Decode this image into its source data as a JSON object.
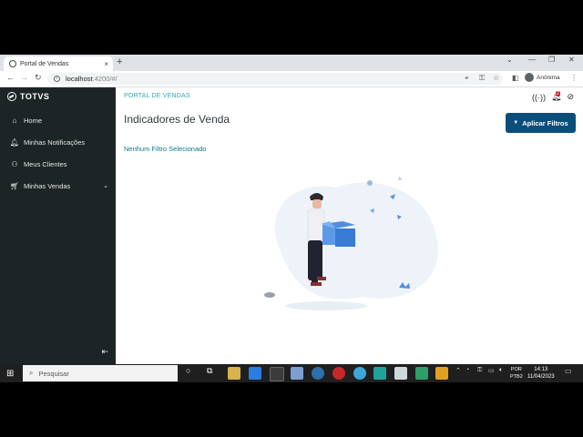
{
  "browser": {
    "tab_title": "Portal de Vendas",
    "tab_close": "×",
    "new_tab": "+",
    "url_host": "localhost",
    "url_path": ":4200/#/",
    "profile_name": "Anônima"
  },
  "app": {
    "brand": "TOTVS",
    "breadcrumb": "PORTAL DE VENDAS",
    "notification_count": "2",
    "page_title": "Indicadores de Venda",
    "apply_button": "Aplicar Filtros",
    "no_filter": "Nenhum Filtro Selecionado",
    "accent": "#2da9b3",
    "primary": "#0c4e7a"
  },
  "sidebar": {
    "items": [
      {
        "label": "Home",
        "icon": "home-icon"
      },
      {
        "label": "Minhas Notificações",
        "icon": "bell-icon"
      },
      {
        "label": "Meus Clientes",
        "icon": "users-icon"
      },
      {
        "label": "Minhas Vendas",
        "icon": "cart-icon"
      }
    ]
  },
  "taskbar": {
    "search_placeholder": "Pesquisar",
    "lang_1": "POR",
    "lang_2": "PTB2",
    "time": "14:13",
    "date": "11/04/2023"
  }
}
